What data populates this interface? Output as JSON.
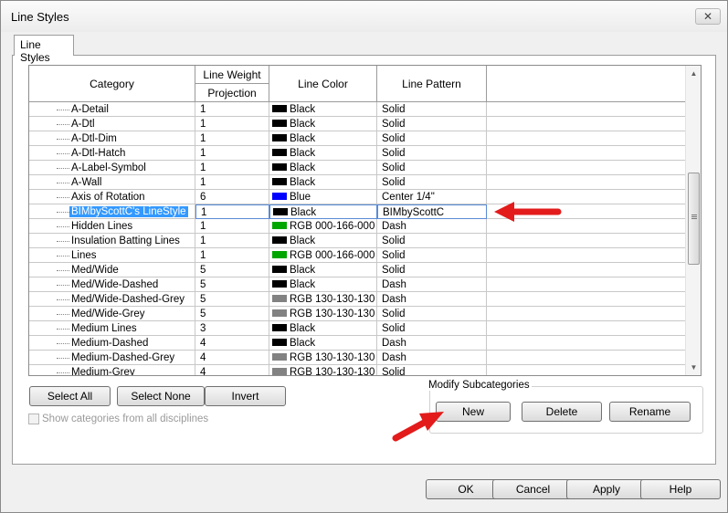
{
  "window": {
    "title": "Line Styles",
    "close_glyph": "✕"
  },
  "tab": {
    "label": "Line Styles"
  },
  "grid": {
    "headers": {
      "category": "Category",
      "line_weight": "Line Weight",
      "projection": "Projection",
      "line_color": "Line Color",
      "line_pattern": "Line Pattern"
    },
    "rows": [
      {
        "category": "A-Detail",
        "weight": "1",
        "color_name": "Black",
        "color": "#000000",
        "pattern": "Solid"
      },
      {
        "category": "A-Dtl",
        "weight": "1",
        "color_name": "Black",
        "color": "#000000",
        "pattern": "Solid"
      },
      {
        "category": "A-Dtl-Dim",
        "weight": "1",
        "color_name": "Black",
        "color": "#000000",
        "pattern": "Solid"
      },
      {
        "category": "A-Dtl-Hatch",
        "weight": "1",
        "color_name": "Black",
        "color": "#000000",
        "pattern": "Solid"
      },
      {
        "category": "A-Label-Symbol",
        "weight": "1",
        "color_name": "Black",
        "color": "#000000",
        "pattern": "Solid"
      },
      {
        "category": "A-Wall",
        "weight": "1",
        "color_name": "Black",
        "color": "#000000",
        "pattern": "Solid"
      },
      {
        "category": "Axis of Rotation",
        "weight": "6",
        "color_name": "Blue",
        "color": "#0000ff",
        "pattern": "Center 1/4\""
      },
      {
        "category": "BIMbyScottC's LineStyle",
        "weight": "1",
        "color_name": "Black",
        "color": "#000000",
        "pattern": "BIMbyScottC",
        "selected": true
      },
      {
        "category": "Hidden Lines",
        "weight": "1",
        "color_name": "RGB 000-166-000",
        "color": "#00a600",
        "pattern": "Dash"
      },
      {
        "category": "Insulation Batting Lines",
        "weight": "1",
        "color_name": "Black",
        "color": "#000000",
        "pattern": "Solid"
      },
      {
        "category": "Lines",
        "weight": "1",
        "color_name": "RGB 000-166-000",
        "color": "#00a600",
        "pattern": "Solid"
      },
      {
        "category": "Med/Wide",
        "weight": "5",
        "color_name": "Black",
        "color": "#000000",
        "pattern": "Solid"
      },
      {
        "category": "Med/Wide-Dashed",
        "weight": "5",
        "color_name": "Black",
        "color": "#000000",
        "pattern": "Dash"
      },
      {
        "category": "Med/Wide-Dashed-Grey",
        "weight": "5",
        "color_name": "RGB 130-130-130",
        "color": "#828282",
        "pattern": "Dash"
      },
      {
        "category": "Med/Wide-Grey",
        "weight": "5",
        "color_name": "RGB 130-130-130",
        "color": "#828282",
        "pattern": "Solid"
      },
      {
        "category": "Medium Lines",
        "weight": "3",
        "color_name": "Black",
        "color": "#000000",
        "pattern": "Solid"
      },
      {
        "category": "Medium-Dashed",
        "weight": "4",
        "color_name": "Black",
        "color": "#000000",
        "pattern": "Dash"
      },
      {
        "category": "Medium-Dashed-Grey",
        "weight": "4",
        "color_name": "RGB 130-130-130",
        "color": "#828282",
        "pattern": "Dash"
      },
      {
        "category": "Medium-Grey",
        "weight": "4",
        "color_name": "RGB 130-130-130",
        "color": "#828282",
        "pattern": "Solid"
      }
    ]
  },
  "buttons": {
    "select_all": "Select All",
    "select_none": "Select None",
    "invert": "Invert",
    "new": "New",
    "delete": "Delete",
    "rename": "Rename",
    "ok": "OK",
    "cancel": "Cancel",
    "apply": "Apply",
    "help": "Help"
  },
  "modify_subcategories": {
    "legend": "Modify Subcategories"
  },
  "show_all_disciplines": {
    "label": "Show categories from all disciplines",
    "checked": false
  },
  "annotation_color": "#e31b1b"
}
